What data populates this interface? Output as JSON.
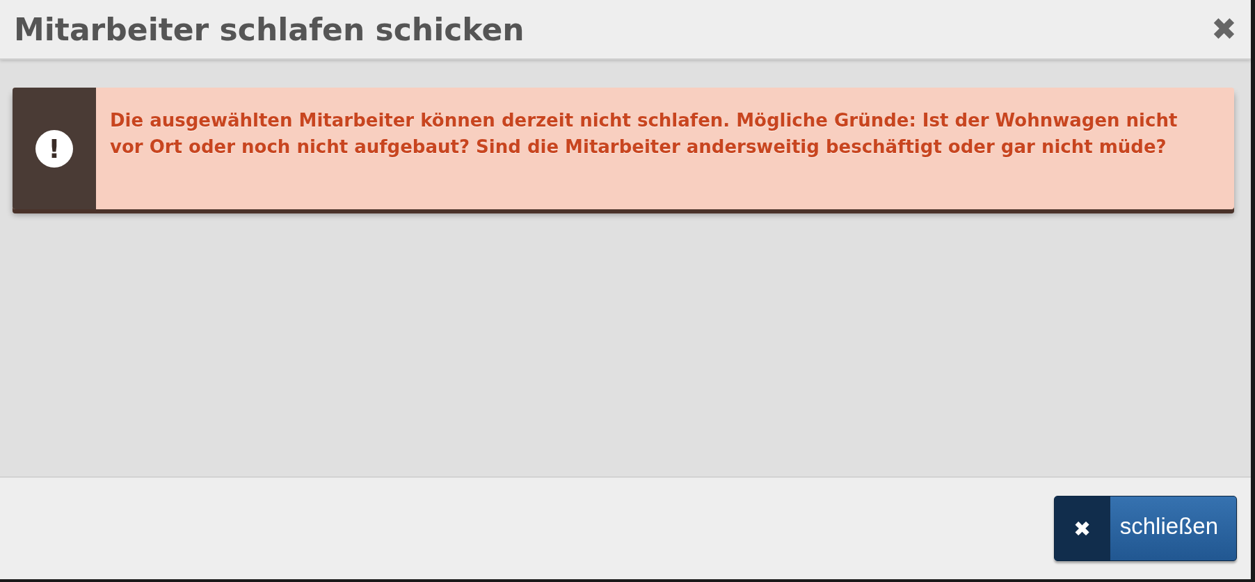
{
  "dialog": {
    "title": "Mitarbeiter schlafen schicken",
    "close_symbol": "✖"
  },
  "alert": {
    "kind": "error",
    "icon": "!",
    "message": "Die ausgewählten Mitarbeiter können derzeit nicht schlafen. Mögliche Gründe: Ist der Wohnwagen nicht vor Ort oder noch nicht aufgebaut? Sind die Mitarbeiter andersweitig beschäftigt oder gar nicht müde?"
  },
  "footer": {
    "buttons": [
      {
        "label": "schließen",
        "icon": "✖"
      }
    ]
  }
}
